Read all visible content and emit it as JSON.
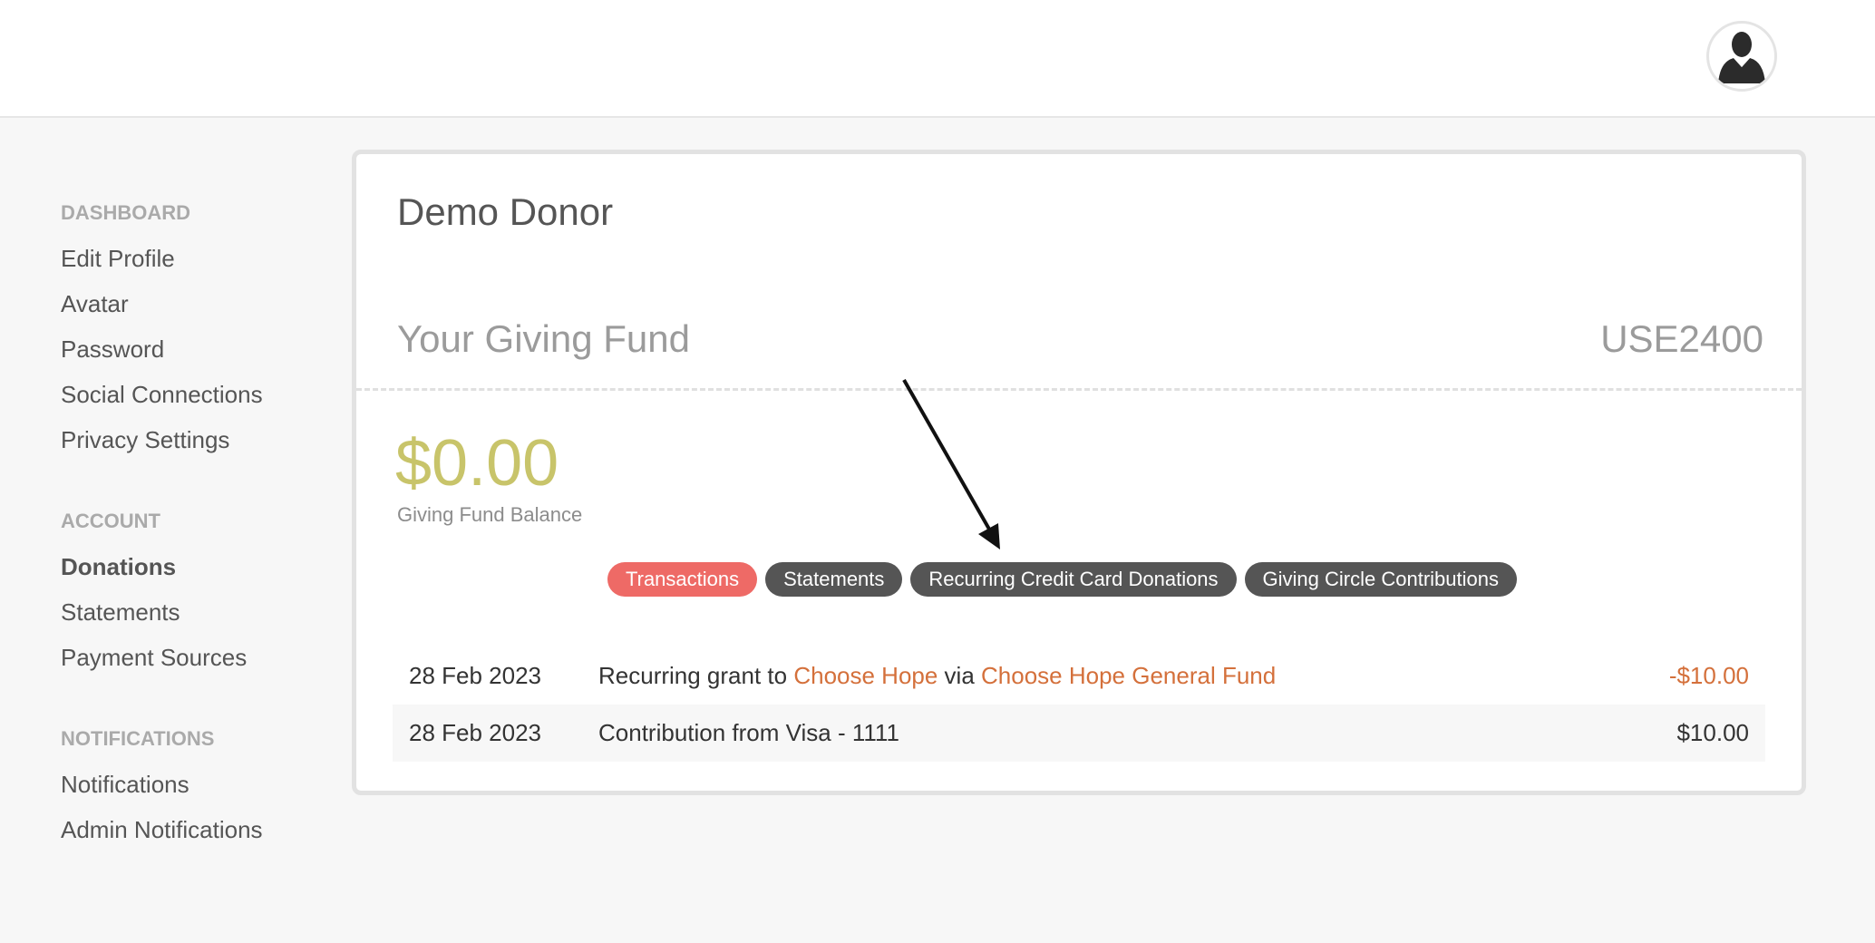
{
  "sidebar": {
    "sections": [
      {
        "heading": "DASHBOARD",
        "items": [
          "Edit Profile",
          "Avatar",
          "Password",
          "Social Connections",
          "Privacy Settings"
        ]
      },
      {
        "heading": "ACCOUNT",
        "items": [
          "Donations",
          "Statements",
          "Payment Sources"
        ]
      },
      {
        "heading": "NOTIFICATIONS",
        "items": [
          "Notifications",
          "Admin Notifications"
        ]
      }
    ],
    "active_item": "Donations"
  },
  "header": {
    "avatar_icon": "user-silhouette-icon"
  },
  "card": {
    "donor_name": "Demo Donor",
    "fund_title": "Your Giving Fund",
    "fund_code": "USE2400",
    "balance": "$0.00",
    "balance_label": "Giving Fund Balance",
    "tabs": [
      {
        "label": "Transactions",
        "active": true
      },
      {
        "label": "Statements",
        "active": false
      },
      {
        "label": "Recurring Credit Card Donations",
        "active": false
      },
      {
        "label": "Giving Circle Contributions",
        "active": false
      }
    ],
    "transactions": [
      {
        "date": "28 Feb 2023",
        "prefix": "Recurring grant to ",
        "link1": "Choose Hope",
        "middle": " via ",
        "link2": "Choose Hope General Fund",
        "amount": "-$10.00"
      },
      {
        "date": "28 Feb 2023",
        "text": "Contribution from Visa - 1111",
        "amount": "$10.00"
      }
    ]
  },
  "colors": {
    "accent_tab": "#ee6a66",
    "dark_tab": "#555555",
    "balance": "#c8c46a",
    "link": "#d4703b"
  }
}
